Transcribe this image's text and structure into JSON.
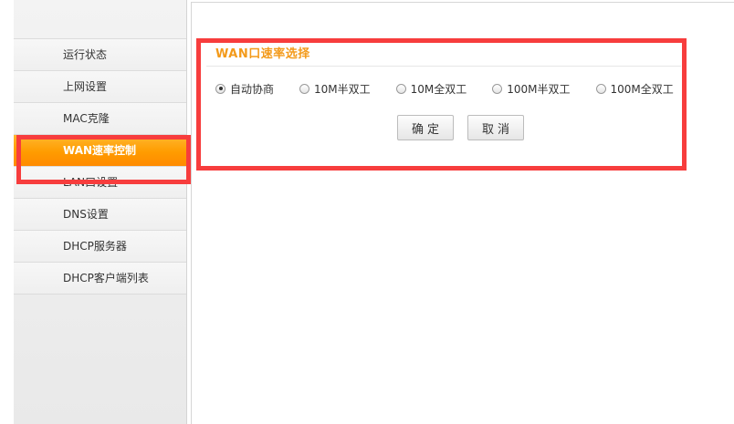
{
  "sidebar": {
    "items": [
      {
        "label": "运行状态",
        "active": false
      },
      {
        "label": "上网设置",
        "active": false
      },
      {
        "label": "MAC克隆",
        "active": false
      },
      {
        "label": "WAN速率控制",
        "active": true
      },
      {
        "label": "LAN口设置",
        "active": false
      },
      {
        "label": "DNS设置",
        "active": false
      },
      {
        "label": "DHCP服务器",
        "active": false
      },
      {
        "label": "DHCP客户端列表",
        "active": false
      }
    ]
  },
  "main": {
    "section_title": "WAN口速率选择",
    "speed_options": [
      {
        "label": "自动协商",
        "checked": true
      },
      {
        "label": "10M半双工",
        "checked": false
      },
      {
        "label": "10M全双工",
        "checked": false
      },
      {
        "label": "100M半双工",
        "checked": false
      },
      {
        "label": "100M全双工",
        "checked": false
      }
    ],
    "ok_label": "确定",
    "cancel_label": "取消"
  },
  "colors": {
    "accent_orange": "#ff9c00",
    "title_orange": "#f39a1a",
    "annotation_red": "#f73d3d"
  }
}
